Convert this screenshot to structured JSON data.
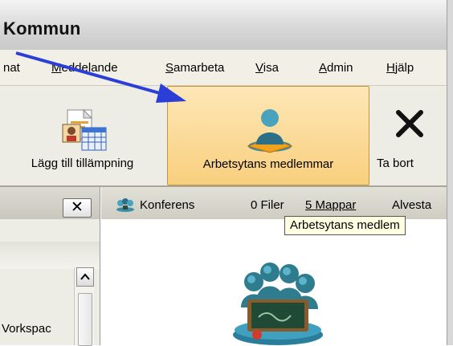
{
  "window": {
    "title": "Kommun"
  },
  "menu": {
    "items": [
      {
        "label": "nat",
        "underline": ""
      },
      {
        "label": "Meddelande",
        "underline": "M"
      },
      {
        "label": "Samarbeta",
        "underline": "S"
      },
      {
        "label": "Visa",
        "underline": "V"
      },
      {
        "label": "Admin",
        "underline": "A"
      },
      {
        "label": "Hjälp",
        "underline": "H"
      }
    ]
  },
  "toolbar": {
    "add_app_label": "Lägg till tillämpning",
    "members_label": "Arbetsytans medlemmar",
    "remove_label": "Ta bort",
    "members_active": true
  },
  "left_panel": {
    "close_symbol": "✕",
    "workspace_label": "Vorkspac"
  },
  "main_panel": {
    "conference_label": "Konferens",
    "files_label": "0 Filer",
    "folders_label": "5 Mappar",
    "location_label": "Alvesta"
  },
  "tooltip": {
    "text": "Arbetsytans medlem"
  },
  "colors": {
    "active_button_bg": "#f9cf7e",
    "pointer_arrow": "#2b3fd6",
    "tooltip_bg": "#ffffe1"
  },
  "icons": [
    "add-application-icon",
    "workspace-members-icon",
    "delete-x-icon",
    "conference-icon",
    "classroom-group-icon",
    "pointer-arrow-annotation"
  ]
}
